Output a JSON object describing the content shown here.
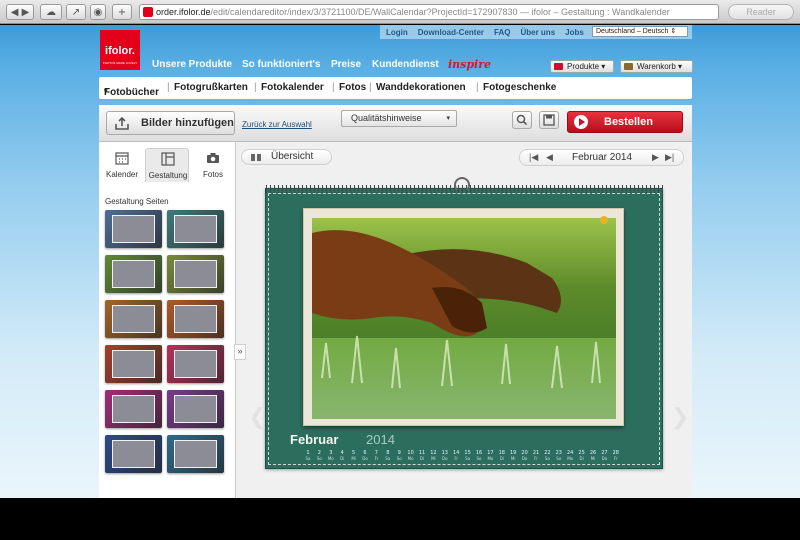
{
  "browser": {
    "url_host": "order.ifolor.de",
    "url_rest": "/edit/calendareditor/index/3/3721100/DE/WallCalendar?ProjectId=172907830",
    "page_title": " — ifolor – Gestaltung : Wandkalender",
    "reader": "Reader"
  },
  "toplinks": {
    "items": [
      "Login",
      "Download-Center",
      "FAQ",
      "Über uns",
      "Jobs"
    ],
    "language": "Deutschland – Deutsch"
  },
  "logo": {
    "name": "ifolor.",
    "tagline": "PHOTOS MADE LOVELY"
  },
  "mainnav": {
    "items": [
      "Unsere Produkte",
      "So funktioniert's",
      "Preise",
      "Kundendienst"
    ],
    "inspire": "inspire",
    "produkte": "Produkte",
    "warenkorb": "Warenkorb"
  },
  "categories": [
    "Fotobücher",
    "Fotogrußkarten",
    "Fotokalender",
    "Fotos",
    "Wanddekorationen",
    "Fotogeschenke"
  ],
  "toolbar": {
    "add_photos": "Bilder hinzufügen",
    "back": "Zurück zur Auswahl",
    "quality": "Qualitätshinweise",
    "order": "Bestellen"
  },
  "leftpanel": {
    "tabs": [
      "Kalender",
      "Gestaltung",
      "Fotos"
    ],
    "title": "Gestaltung Seiten",
    "thumb_colors": [
      "#4e6e96",
      "#3f7a7a",
      "#5f8a3a",
      "#7a8a3a",
      "#a0662a",
      "#b05a26",
      "#a4402c",
      "#b8305a",
      "#a02e78",
      "#7a3a8a",
      "#2e4a8a",
      "#2e6a8a"
    ]
  },
  "calendar": {
    "overview": "Übersicht",
    "month_label": "Februar 2014",
    "month": "Februar",
    "year": "2014",
    "bg_color": "#2c6e5e",
    "days": [
      "1",
      "2",
      "3",
      "4",
      "5",
      "6",
      "7",
      "8",
      "9",
      "10",
      "11",
      "12",
      "13",
      "14",
      "15",
      "16",
      "17",
      "18",
      "19",
      "20",
      "21",
      "22",
      "23",
      "24",
      "25",
      "26",
      "27",
      "28"
    ],
    "weekdays": [
      "Sa",
      "So",
      "Mo",
      "Di",
      "Mi",
      "Do",
      "Fr",
      "Sa",
      "So",
      "Mo",
      "Di",
      "Mi",
      "Do",
      "Fr",
      "Sa",
      "So",
      "Mo",
      "Di",
      "Mi",
      "Do",
      "Fr",
      "Sa",
      "So",
      "Mo",
      "Di",
      "Mi",
      "Do",
      "Fr"
    ]
  }
}
